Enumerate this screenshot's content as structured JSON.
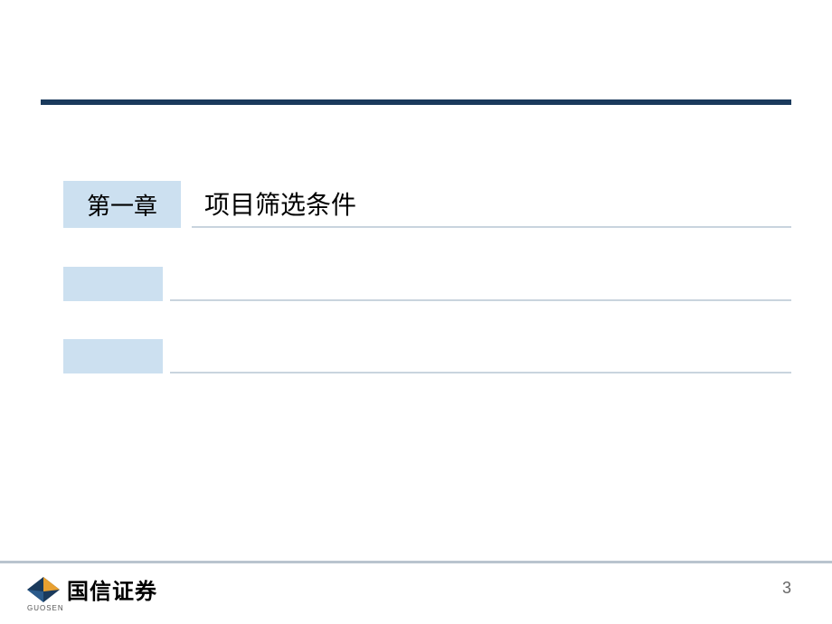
{
  "chapter": {
    "label": "第一章",
    "title": "项目筛选条件"
  },
  "rows": [
    {
      "label": "",
      "title": ""
    },
    {
      "label": "",
      "title": ""
    }
  ],
  "footer": {
    "company": "国信证券",
    "company_en": "GUOSEN",
    "page_number": "3"
  }
}
